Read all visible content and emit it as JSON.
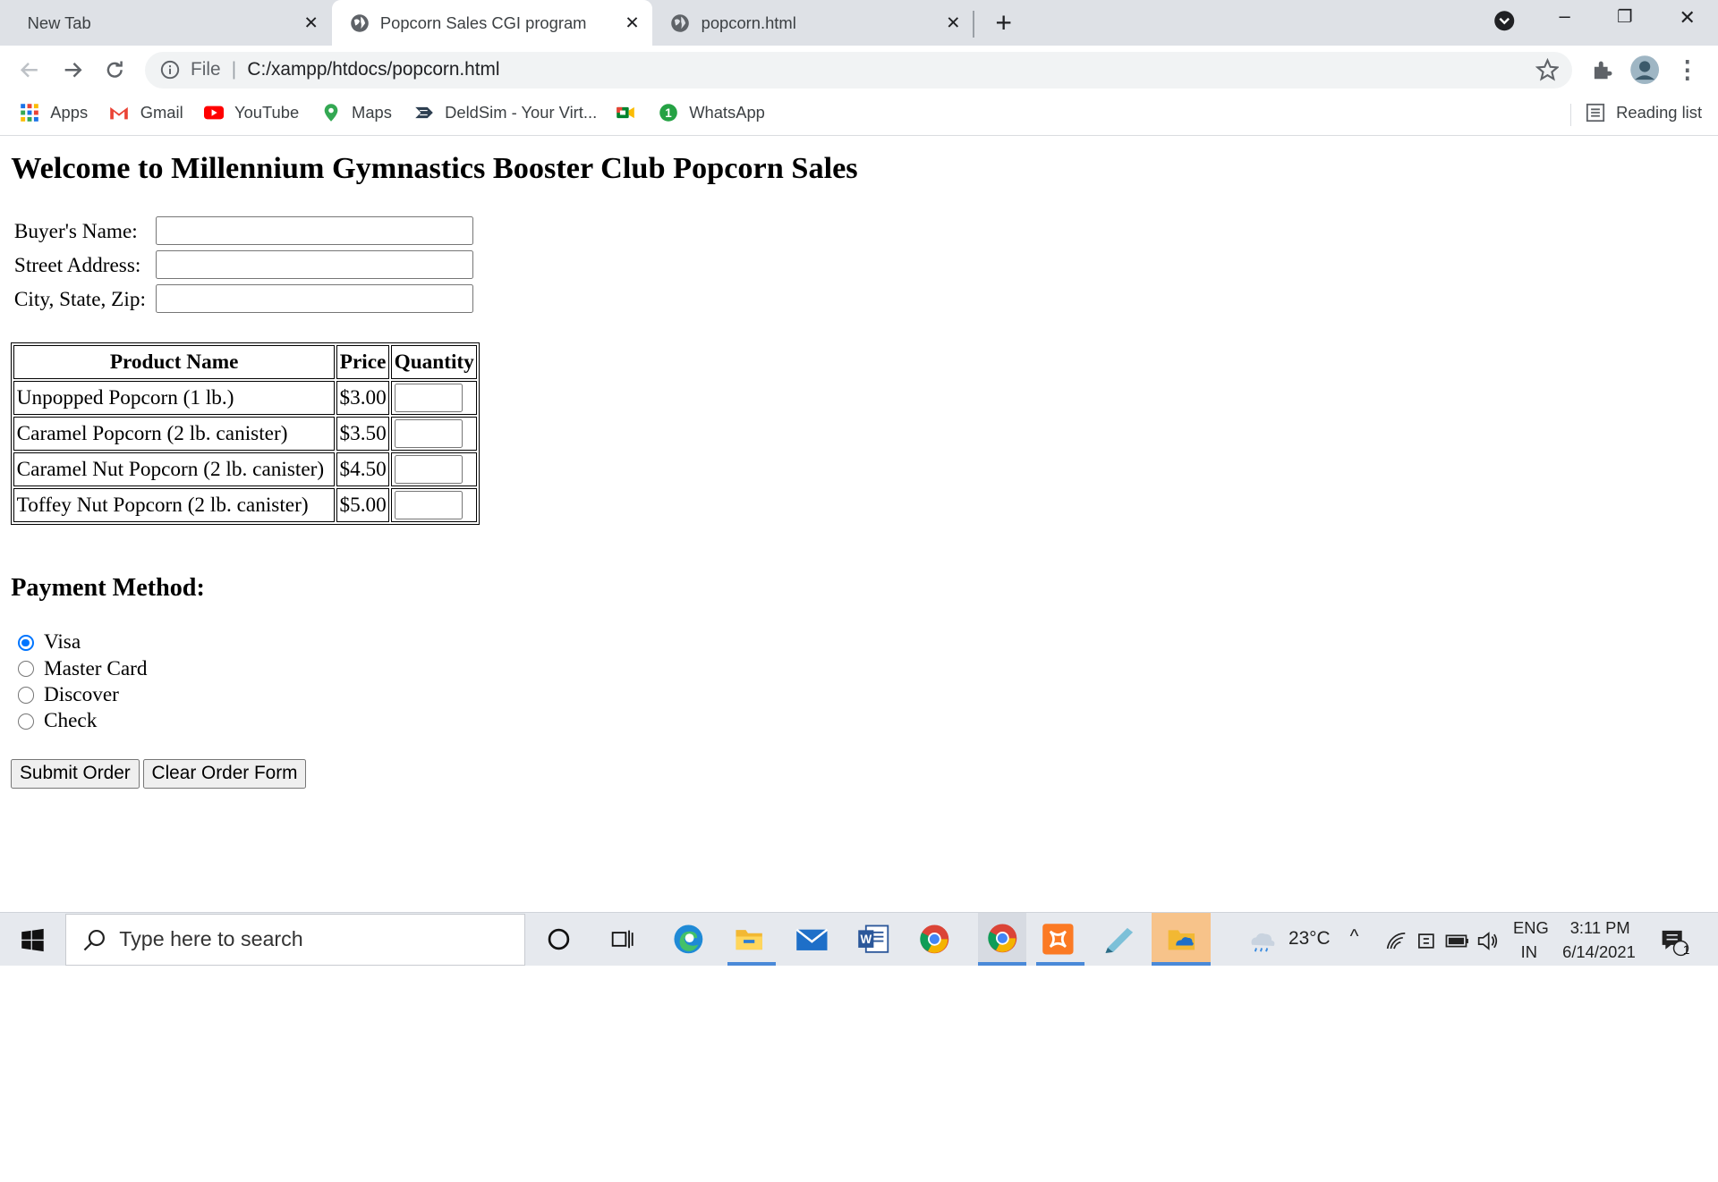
{
  "browser": {
    "tabs": [
      {
        "label": "New Tab",
        "active": false
      },
      {
        "label": "Popcorn Sales CGI program",
        "active": true
      },
      {
        "label": "popcorn.html",
        "active": false
      }
    ],
    "address": {
      "scheme_label": "File",
      "url": "C:/xampp/htdocs/popcorn.html"
    },
    "bookmarks": [
      {
        "label": "Apps",
        "icon": "apps-grid-icon"
      },
      {
        "label": "Gmail",
        "icon": "gmail-icon"
      },
      {
        "label": "YouTube",
        "icon": "youtube-icon"
      },
      {
        "label": "Maps",
        "icon": "maps-pin-icon"
      },
      {
        "label": "DeldSim - Your Virt...",
        "icon": "deldsim-icon"
      },
      {
        "label": "",
        "icon": "meet-icon"
      },
      {
        "label": "WhatsApp",
        "icon": "whatsapp-icon"
      }
    ],
    "reading_list": "Reading list"
  },
  "page": {
    "heading": "Welcome to Millennium Gymnastics Booster Club Popcorn Sales",
    "fields": [
      {
        "label": "Buyer's Name:",
        "value": ""
      },
      {
        "label": "Street Address:",
        "value": ""
      },
      {
        "label": "City, State, Zip:",
        "value": ""
      }
    ],
    "table": {
      "headers": [
        "Product Name",
        "Price",
        "Quantity"
      ],
      "rows": [
        {
          "name": "Unpopped Popcorn (1 lb.)",
          "price": "$3.00",
          "qty": ""
        },
        {
          "name": "Caramel Popcorn (2 lb. canister)",
          "price": "$3.50",
          "qty": ""
        },
        {
          "name": "Caramel Nut Popcorn (2 lb. canister)",
          "price": "$4.50",
          "qty": ""
        },
        {
          "name": "Toffey Nut Popcorn (2 lb. canister)",
          "price": "$5.00",
          "qty": ""
        }
      ]
    },
    "payment": {
      "heading": "Payment Method:",
      "options": [
        {
          "label": "Visa",
          "checked": true
        },
        {
          "label": "Master Card",
          "checked": false
        },
        {
          "label": "Discover",
          "checked": false
        },
        {
          "label": "Check",
          "checked": false
        }
      ]
    },
    "buttons": {
      "submit": "Submit Order",
      "clear": "Clear Order Form"
    }
  },
  "taskbar": {
    "search_placeholder": "Type here to search",
    "weather": "23°C",
    "language": "ENG",
    "region": "IN",
    "time": "3:11 PM",
    "date": "6/14/2021",
    "notification_count": "1"
  },
  "colors": {
    "tab_strip": "#dee1e6",
    "radio_accent": "#0075ff",
    "taskbar": "#e6e9ee"
  }
}
